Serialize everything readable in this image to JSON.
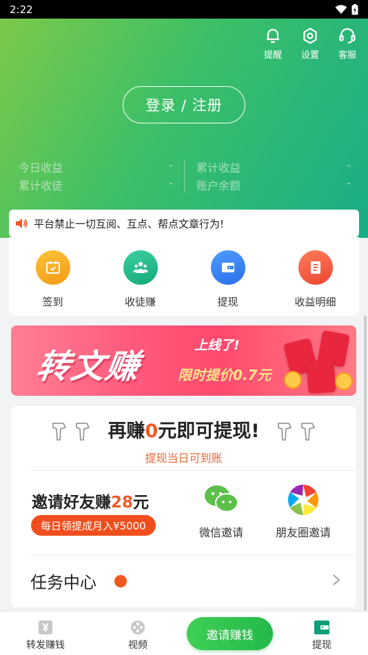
{
  "status_bar": {
    "time": "2:22"
  },
  "header": {
    "actions": [
      {
        "label": "提醒",
        "icon": "bell-icon"
      },
      {
        "label": "设置",
        "icon": "gear-icon"
      },
      {
        "label": "客服",
        "icon": "headset-icon"
      }
    ],
    "login_label": "登录 / 注册",
    "stats": [
      {
        "label": "今日收益",
        "value": "-"
      },
      {
        "label": "累计收益",
        "value": "-"
      },
      {
        "label": "累计收徒",
        "value": "-"
      },
      {
        "label": "账户余额",
        "value": "-"
      }
    ]
  },
  "notice": {
    "text": "平台禁止一切互阅、互点、帮点文章行为!",
    "icon": "speaker-icon"
  },
  "quick_actions": [
    {
      "label": "签到",
      "icon": "calendar-icon",
      "color": "#f7a21b"
    },
    {
      "label": "收徒赚",
      "icon": "people-icon",
      "color": "#23b48a"
    },
    {
      "label": "提现",
      "icon": "wallet-icon",
      "color": "#2f7ff2"
    },
    {
      "label": "收益明细",
      "icon": "document-icon",
      "color": "#f0553a"
    }
  ],
  "banner": {
    "title": "转文赚",
    "tag_online": "上线了!",
    "tag_price": "限时提价0.7元"
  },
  "withdraw": {
    "prefix": "再赚",
    "amount": "0",
    "suffix": "元即可提现!",
    "sub": "提现当日可到账"
  },
  "invite": {
    "title_prefix": "邀请好友赚",
    "amount": "28",
    "title_suffix": "元",
    "pill": "每日领提成月入¥5000",
    "share_wechat": "微信邀请",
    "share_moments": "朋友圈邀请"
  },
  "task_center": {
    "label": "任务中心"
  },
  "tabbar": {
    "tabs": [
      {
        "label": "转发赚钱",
        "icon": "yen-icon"
      },
      {
        "label": "视频",
        "icon": "film-reel-icon"
      },
      {
        "label": "提现",
        "icon": "wallet-icon"
      }
    ],
    "cta": "邀请赚钱"
  },
  "colors": {
    "accent": "#f05a28",
    "green": "#23b94a"
  }
}
